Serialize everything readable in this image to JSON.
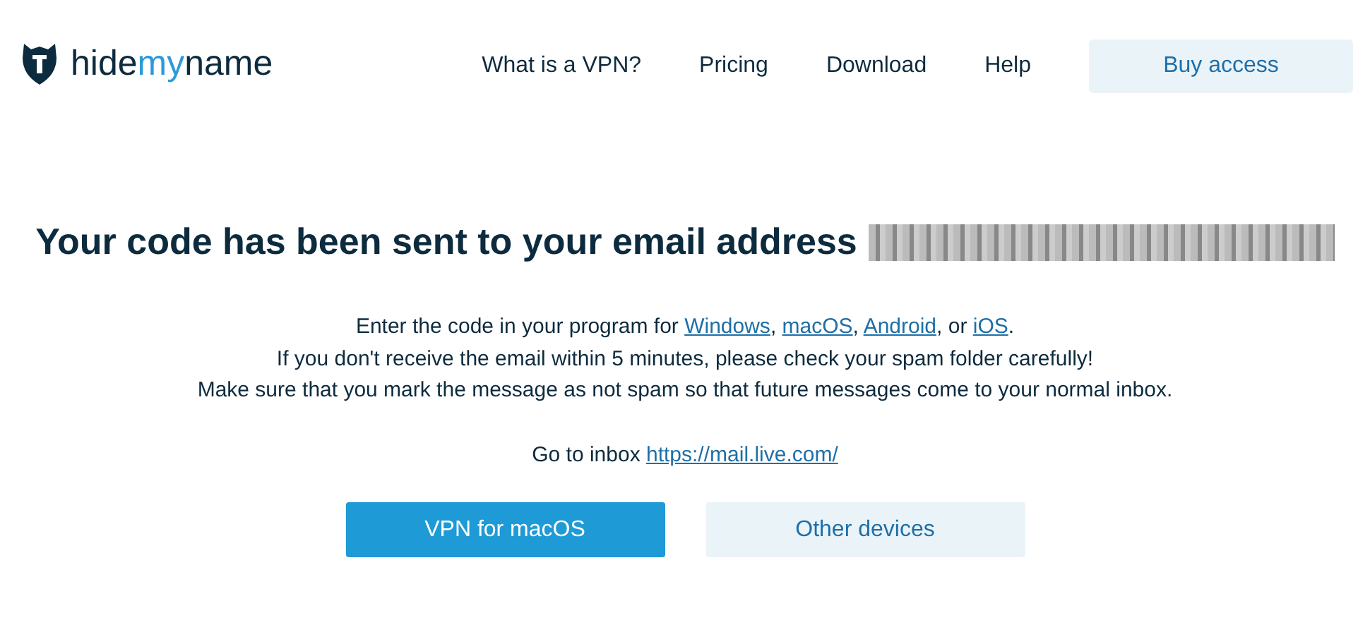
{
  "header": {
    "logo": {
      "prefix": "hide",
      "accent": "my",
      "suffix": "name"
    },
    "nav": [
      "What is a VPN?",
      "Pricing",
      "Download",
      "Help"
    ],
    "cta": "Buy access"
  },
  "heading": {
    "text": "Your code has been sent to your email address",
    "email_redacted": true
  },
  "instructions": [
    [
      {
        "kind": "text",
        "text": "Enter the code in your program for "
      },
      {
        "kind": "link",
        "text": "Windows"
      },
      {
        "kind": "text",
        "text": ", "
      },
      {
        "kind": "link",
        "text": "macOS"
      },
      {
        "kind": "text",
        "text": ", "
      },
      {
        "kind": "link",
        "text": "Android"
      },
      {
        "kind": "text",
        "text": ", or "
      },
      {
        "kind": "link",
        "text": "iOS"
      },
      {
        "kind": "text",
        "text": "."
      }
    ],
    [
      {
        "kind": "text",
        "text": "If you don't receive the email within 5 minutes, please check your spam folder carefully!"
      }
    ],
    [
      {
        "kind": "text",
        "text": "Make sure that you mark the message as not spam so that future messages come to your normal inbox."
      }
    ]
  ],
  "inbox": {
    "label": "Go to inbox",
    "link": "https://mail.live.com/"
  },
  "buttons": [
    {
      "label": "VPN for macOS",
      "kind": "primary"
    },
    {
      "label": "Other devices",
      "kind": "secondary"
    }
  ]
}
